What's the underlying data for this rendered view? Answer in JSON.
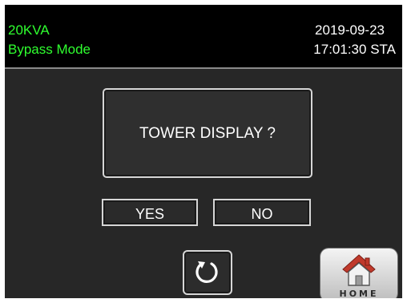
{
  "status_bar": {
    "model": "20KVA",
    "mode": "Bypass Mode",
    "date": "2019-09-23",
    "time": "17:01:30 STA"
  },
  "dialog": {
    "message": "TOWER DISPLAY ?",
    "yes_label": "YES",
    "no_label": "NO"
  },
  "nav": {
    "back_icon": "refresh-back-icon",
    "home_icon": "home-icon",
    "home_label": "HOME"
  },
  "colors": {
    "status_text": "#2fff2f",
    "background": "#272727",
    "header": "#000000",
    "border": "#d6d6d6",
    "home_roof": "#c0392b"
  }
}
